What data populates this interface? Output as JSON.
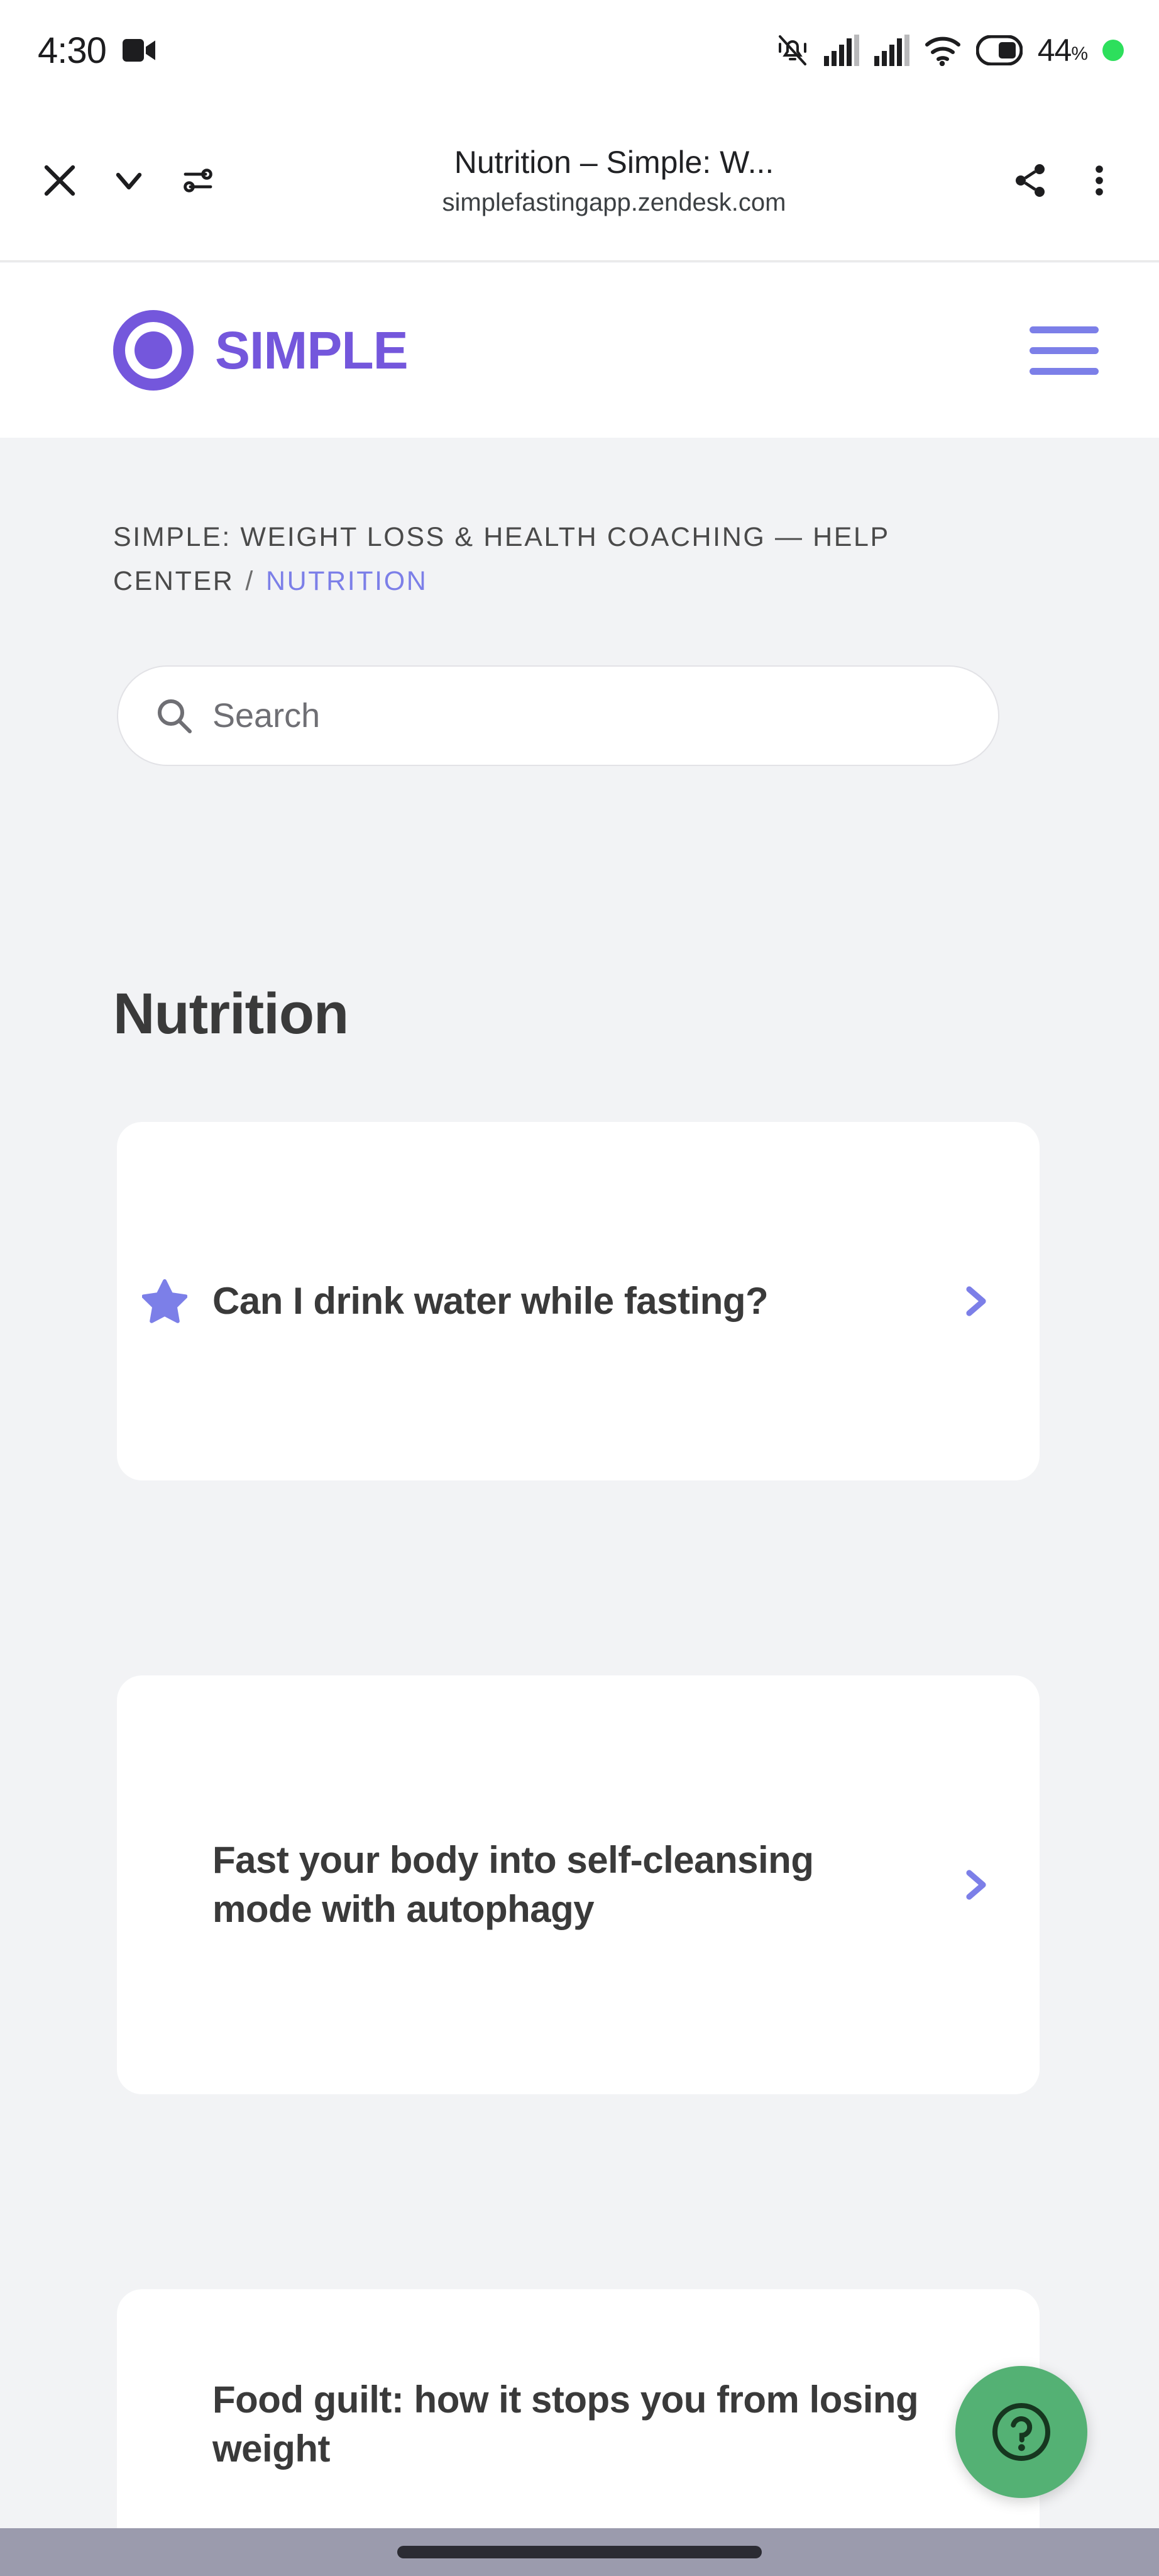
{
  "status_bar": {
    "time": "4:30",
    "camera_icon": "video-camera-icon",
    "vibrate_off_icon": "bell-vibrate-off-icon",
    "signal_icon_1": "cellular-signal-icon",
    "signal_icon_2": "cellular-signal-icon",
    "wifi_icon": "wifi-icon",
    "battery_icon": "battery-icon",
    "battery_percent": "44",
    "percent_symbol": "%",
    "recording_dot": "green-status-dot"
  },
  "browser_toolbar": {
    "close_icon": "close-icon",
    "collapse_icon": "chevron-down-icon",
    "page_info_icon": "page-settings-icon",
    "title": "Nutrition – Simple: W...",
    "url": "simplefastingapp.zendesk.com",
    "share_icon": "share-icon",
    "overflow_icon": "more-vertical-icon"
  },
  "site_header": {
    "logo_mark": "simple-ring-logo-icon",
    "logo_word": "SIMPLE",
    "menu_icon": "hamburger-menu-icon"
  },
  "breadcrumb": {
    "root": "SIMPLE: WEIGHT LOSS & HEALTH COACHING — HELP CENTER",
    "separator": "/",
    "current": "NUTRITION"
  },
  "search": {
    "icon": "search-icon",
    "placeholder": "Search",
    "value": ""
  },
  "main": {
    "page_title": "Nutrition",
    "articles": [
      {
        "title": "Can I drink water while fasting?",
        "promoted": true,
        "star_icon": "star-icon",
        "chevron_icon": "chevron-right-icon"
      },
      {
        "title": "Fast your body into self-cleansing mode with autophagy",
        "promoted": false,
        "chevron_icon": "chevron-right-icon"
      },
      {
        "title": "Food guilt: how it stops you from losing weight",
        "promoted": false,
        "chevron_icon": "chevron-right-icon"
      }
    ]
  },
  "help_widget": {
    "icon": "question-mark-circle-icon",
    "label": "Help"
  },
  "nav_bar": {
    "gesture_pill": "home-gesture-pill"
  },
  "colors": {
    "brand_purple": "#7457DC",
    "accent_periwinkle": "#7C7FE8",
    "page_background": "#F2F3F5",
    "card_background": "#FFFFFF",
    "help_green": "#54B174",
    "nav_bar": "#9B9BAD",
    "battery_dot_green": "#2DDF5C"
  }
}
